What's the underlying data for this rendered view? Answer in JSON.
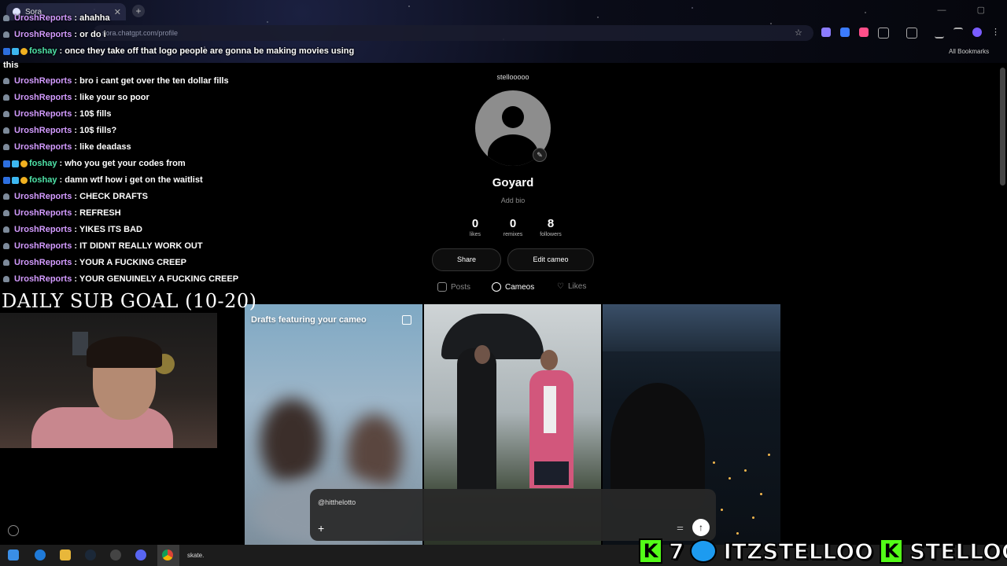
{
  "browser": {
    "tab_title": "Sora",
    "tab_close": "✕",
    "new_tab": "+",
    "url": "sora.chatgpt.com/profile",
    "bookmarks_label": "All Bookmarks",
    "window_controls": "— ▢"
  },
  "chat": {
    "messages": [
      {
        "user": "UroshReports",
        "text": ": ahahha"
      },
      {
        "user": "UroshReports",
        "text": ": or do i"
      },
      {
        "user": "foshay",
        "text": ": once they take off that logo people are gonna be making movies using"
      },
      {
        "user": "",
        "text": "this"
      },
      {
        "user": "UroshReports",
        "text": ": bro i cant get over the ten dollar fills"
      },
      {
        "user": "UroshReports",
        "text": ": like your so poor"
      },
      {
        "user": "UroshReports",
        "text": ": 10$ fills"
      },
      {
        "user": "UroshReports",
        "text": ": 10$ fills?"
      },
      {
        "user": "UroshReports",
        "text": ": like deadass"
      },
      {
        "user": "foshay",
        "text": ": who you get your codes from"
      },
      {
        "user": "foshay",
        "text": ": damn wtf how i get on the waitlist"
      },
      {
        "user": "UroshReports",
        "text": ": CHECK DRAFTS"
      },
      {
        "user": "UroshReports",
        "text": ": REFRESH"
      },
      {
        "user": "UroshReports",
        "text": ": YIKES ITS BAD"
      },
      {
        "user": "UroshReports",
        "text": ": IT DIDNT REALLY WORK OUT"
      },
      {
        "user": "UroshReports",
        "text": ": YOUR A FUCKING CREEP"
      },
      {
        "user": "UroshReports",
        "text": ": YOUR GENUINELY A FUCKING CREEP"
      }
    ],
    "goal": "DAILY SUB GOAL (10-20)"
  },
  "profile": {
    "handle": "stellooooo",
    "name": "Goyard",
    "bio_placeholder": "Add bio",
    "stats": [
      {
        "value": "0",
        "label": "likes"
      },
      {
        "value": "0",
        "label": "remixes"
      },
      {
        "value": "8",
        "label": "followers"
      }
    ],
    "share_label": "Share",
    "edit_label": "Edit cameo",
    "tabs": [
      {
        "label": "Posts"
      },
      {
        "label": "Cameos"
      },
      {
        "label": "Likes"
      }
    ],
    "drafts_title": "Drafts featuring your cameo"
  },
  "prompt": {
    "tag": "@hitthelotto",
    "plus": "+",
    "send": "↑",
    "settings": "⚌"
  },
  "taskbar": {
    "app_text": "skate."
  },
  "overlay": {
    "kick_count": "7",
    "twitter": "ITZSTELLOO",
    "kick_name": "STELLOOO",
    "kick_logo": "K"
  },
  "colors": {
    "chat_user_purple": "#d39bff",
    "chat_user_green": "#4fe3a8",
    "kick_green": "#53fc18",
    "twitter_blue": "#1d9bf0"
  }
}
